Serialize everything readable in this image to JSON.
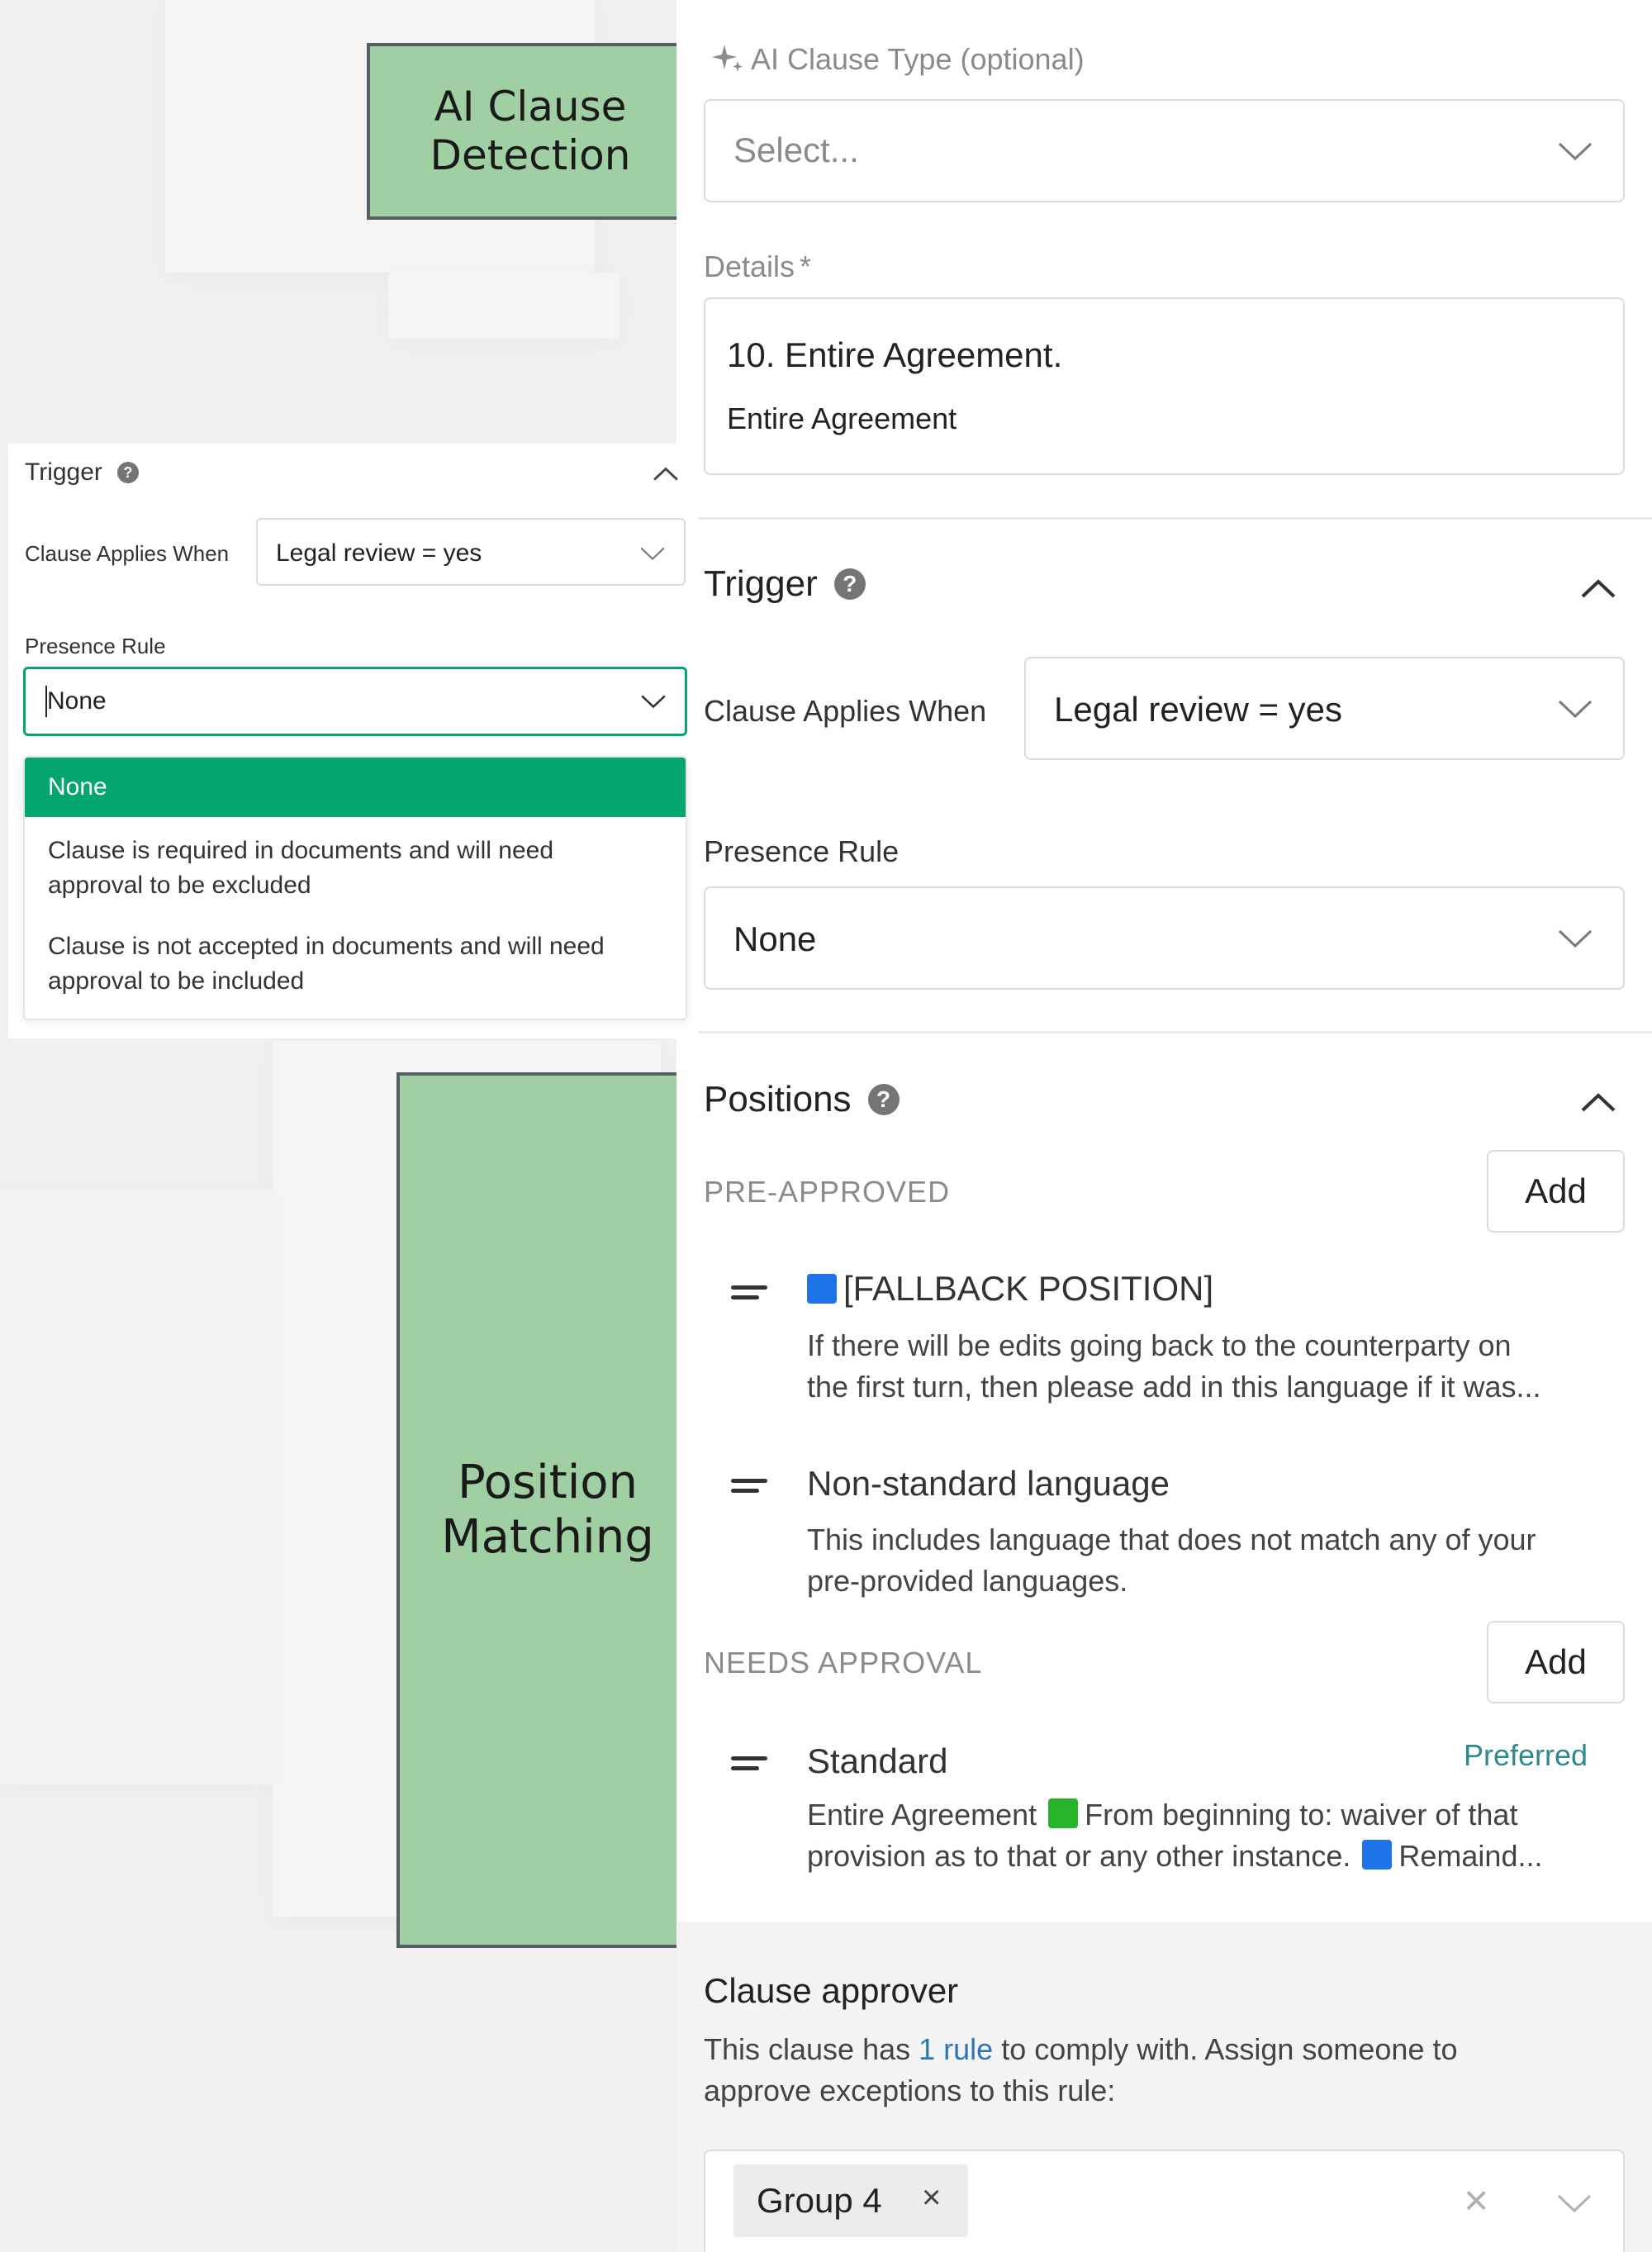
{
  "callouts": {
    "ai_detection": "AI Clause\nDetection",
    "position_matching": "Position\nMatching"
  },
  "ai_clause_type": {
    "label": "AI Clause Type (optional)",
    "placeholder": "Select..."
  },
  "details": {
    "label": "Details",
    "required_mark": "*",
    "line1": "10. Entire Agreement.",
    "line2": "Entire Agreement"
  },
  "trigger": {
    "title": "Trigger",
    "help": "?",
    "applies_label": "Clause Applies When",
    "applies_value": "Legal review = yes",
    "presence_label": "Presence Rule",
    "presence_value": "None"
  },
  "inset": {
    "title": "Trigger",
    "help": "?",
    "applies_label": "Clause Applies When",
    "applies_value": "Legal review = yes",
    "presence_label": "Presence Rule",
    "presence_value": "None",
    "options": [
      "None",
      "Clause is required in documents and will need approval to be excluded",
      "Clause is not accepted in documents and will need approval to be included"
    ]
  },
  "positions": {
    "title": "Positions",
    "help": "?",
    "pre_approved_label": "PRE-APPROVED",
    "needs_approval_label": "NEEDS APPROVAL",
    "add_label": "Add",
    "items": [
      {
        "title": "[FALLBACK POSITION]",
        "line1": "If there will be edits going back to the counterparty on",
        "line2": "the first turn, then please add in this language if it was..."
      },
      {
        "title": "Non-standard language",
        "line1": "This includes language that does not match any of your",
        "line2": "pre-provided languages."
      },
      {
        "title": "Standard",
        "badge": "Preferred",
        "line1_a": "Entire Agreement",
        "line1_b": "From beginning to: waiver of that",
        "line2_a": "provision as to that or any other instance.",
        "line2_b": "Remaind..."
      }
    ]
  },
  "approver": {
    "title": "Clause approver",
    "text_a": "This clause has",
    "link": "1 rule",
    "text_b": "to comply with. Assign someone to",
    "text_c": "approve exceptions to this rule:",
    "chip": "Group 4",
    "chip_remove": "×",
    "clear": "×"
  },
  "colors": {
    "accent_green": "#04a56e",
    "callout_green": "#9fcfa3",
    "link_blue": "#2f75b5",
    "preferred_teal": "#2e8a8a"
  },
  "icons": {
    "sparkle": "sparkle-icon",
    "chevron": "chevron-down-icon",
    "collapse": "chevron-up-icon",
    "drag": "drag-handle-icon",
    "help": "help-icon"
  }
}
